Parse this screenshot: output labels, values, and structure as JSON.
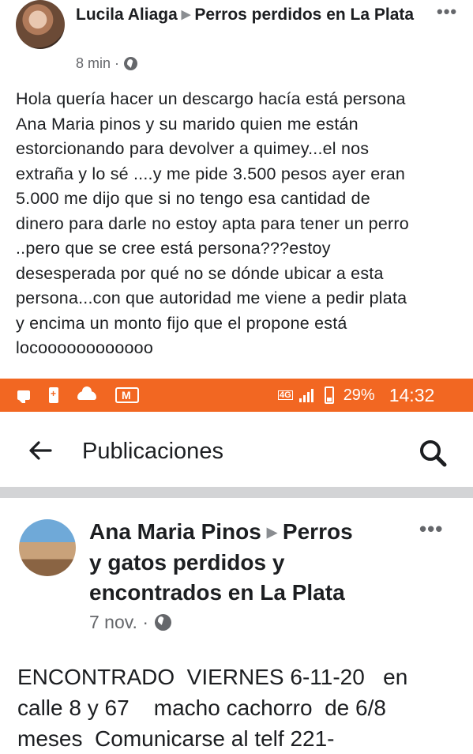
{
  "post1": {
    "author": "Lucila Aliaga",
    "group": "Perros perdidos en La Plata",
    "time": "8 min ·",
    "lines": [
      "Hola quería hacer un descargo hacía está persona",
      "Ana Maria pinos y su marido quien me están",
      "estorcionando para devolver a quimey...el nos",
      "extraña y lo sé ....y me pide 3.500 pesos ayer eran",
      "5.000 me dijo que si no tengo esa cantidad de",
      "dinero para darle no estoy apta para tener un perro",
      "..pero que se cree está persona???estoy",
      "desesperada por qué no se dónde ubicar a esta",
      "persona...con que autoridad me viene a pedir plata",
      "y encima un monto fijo que el propone está",
      "locoooooooooooo"
    ],
    "more": "•••"
  },
  "status_bar": {
    "network": "4G",
    "battery": "29%",
    "time": "14:32",
    "accent": "#f26722"
  },
  "nav": {
    "title": "Publicaciones"
  },
  "post2": {
    "author": "Ana Maria Pinos",
    "group_line1": "Perros",
    "group_line2": "y gatos perdidos y",
    "group_line3": "encontrados en La Plata",
    "time": "7 nov. ·",
    "more": "•••",
    "lines": [
      "ENCONTRADO  VIERNES 6-11-20   en",
      "calle 8 y 67    macho cachorro  de 6/8",
      "meses  Comunicarse al telf 221-"
    ]
  }
}
